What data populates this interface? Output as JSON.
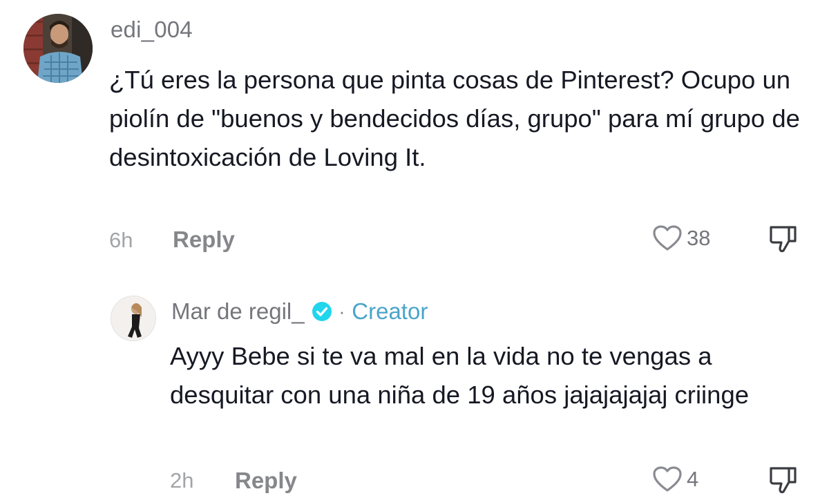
{
  "comments": [
    {
      "username": "edi_004",
      "text": "¿Tú eres la persona que pinta cosas de Pinterest? Ocupo un piolín de \"buenos y bendecidos días, grupo\" para mí grupo de desintoxicación de Loving It.",
      "time": "6h",
      "reply_label": "Reply",
      "likes": "38",
      "avatar_icon": "user-avatar-photo",
      "like_icon": "heart-icon",
      "dislike_icon": "thumbs-down-icon"
    },
    {
      "username": "Mar de regil_",
      "verified": true,
      "separator": "·",
      "creator_label": "Creator",
      "text": "Ayyy Bebe si te va mal en la vida no te vengas a desquitar con una niña de 19 años jajajajajaj criinge",
      "time": "2h",
      "reply_label": "Reply",
      "likes": "4",
      "avatar_icon": "creator-avatar-photo",
      "like_icon": "heart-icon",
      "dislike_icon": "thumbs-down-icon"
    }
  ],
  "colors": {
    "text": "#161823",
    "secondary": "#75767c",
    "muted": "#a3a4a8",
    "creator": "#4ba4c9",
    "verified_badge": "#20d5ec"
  }
}
